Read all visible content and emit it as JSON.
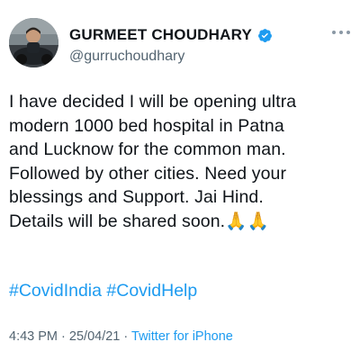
{
  "tweet": {
    "author": {
      "display_name": "GURMEET CHOUDHARY",
      "handle": "@gurruchoudhary",
      "verified": true,
      "avatar_icon": "profile-photo"
    },
    "text": "I have decided I will be opening ultra\nmodern 1000 bed hospital in Patna\nand Lucknow for the common man.\nFollowed by other cities. Need your\nblessings and Support. Jai Hind.\nDetails will be shared soon.🙏🙏",
    "hashtags": [
      "#CovidIndia",
      "#CovidHelp"
    ],
    "time": "4:43 PM",
    "separator": "·",
    "date": "25/04/21",
    "source": "Twitter for iPhone",
    "more_icon": "more-options-icon"
  },
  "colors": {
    "link": "#1d9bf0",
    "text": "#0f1419",
    "secondary": "#536471",
    "verified": "#1d9bf0"
  }
}
